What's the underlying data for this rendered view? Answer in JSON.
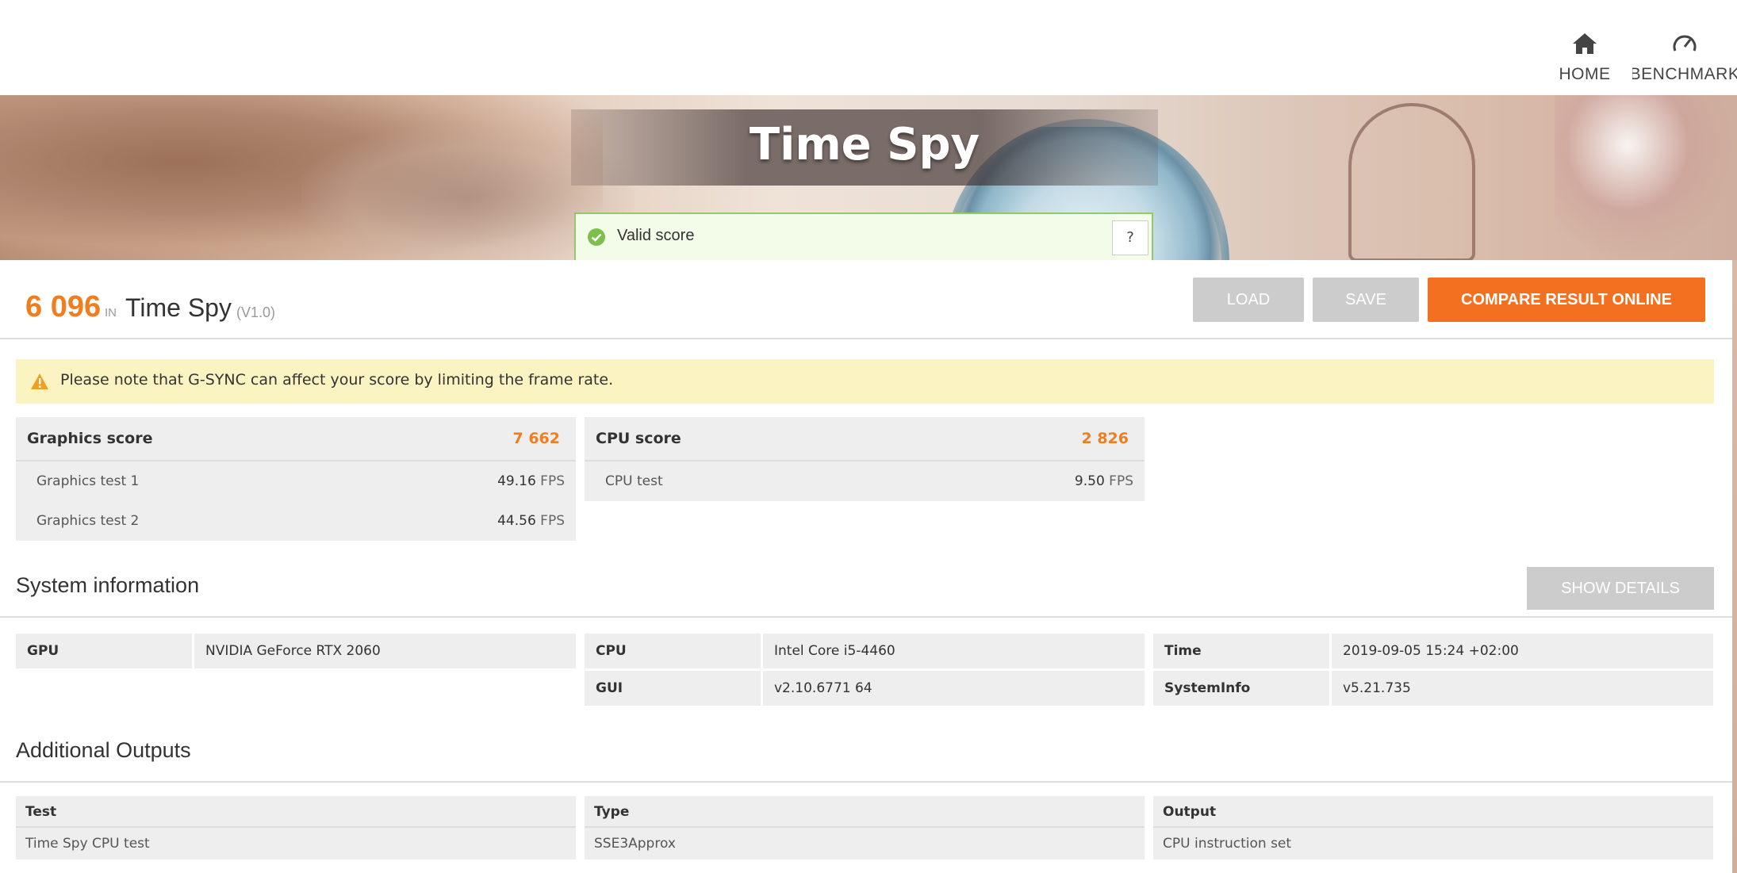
{
  "nav": {
    "home_label": "HOME",
    "benchmarks_label": "BENCHMARK",
    "home_icon": "home-icon",
    "benchmarks_icon": "speedometer-icon"
  },
  "hero": {
    "title": "Time Spy"
  },
  "validity": {
    "text": "Valid score",
    "help_label": "?",
    "color": "#7cbf4a"
  },
  "result": {
    "score": "6 096",
    "in_label": "IN",
    "benchmark_name": "Time Spy",
    "version": "(V1.0)",
    "accent_color": "#f07d1e"
  },
  "buttons": {
    "load": "LOAD",
    "save": "SAVE",
    "compare": "COMPARE RESULT ONLINE",
    "show_details": "SHOW DETAILS"
  },
  "warning": {
    "text": "Please note that G-SYNC can affect your score by limiting the frame rate.",
    "icon": "warning-icon"
  },
  "graphics": {
    "label": "Graphics score",
    "value": "7 662",
    "tests": [
      {
        "label": "Graphics test 1",
        "value": "49.16",
        "unit": "FPS"
      },
      {
        "label": "Graphics test 2",
        "value": "44.56",
        "unit": "FPS"
      }
    ]
  },
  "cpu": {
    "label": "CPU score",
    "value": "2 826",
    "tests": [
      {
        "label": "CPU test",
        "value": "9.50",
        "unit": "FPS"
      }
    ]
  },
  "system_info": {
    "title": "System information",
    "items": [
      {
        "key": "GPU",
        "value": "NVIDIA GeForce RTX 2060"
      },
      {
        "key": "CPU",
        "value": "Intel Core i5-4460"
      },
      {
        "key": "GUI",
        "value": "v2.10.6771 64"
      },
      {
        "key": "Time",
        "value": "2019-09-05 15:24 +02:00"
      },
      {
        "key": "SystemInfo",
        "value": "v5.21.735"
      }
    ]
  },
  "additional_outputs": {
    "title": "Additional Outputs",
    "columns": [
      "Test",
      "Type",
      "Output"
    ],
    "rows": [
      [
        "Time Spy CPU test",
        "SSE3Approx",
        "CPU instruction set"
      ]
    ]
  }
}
